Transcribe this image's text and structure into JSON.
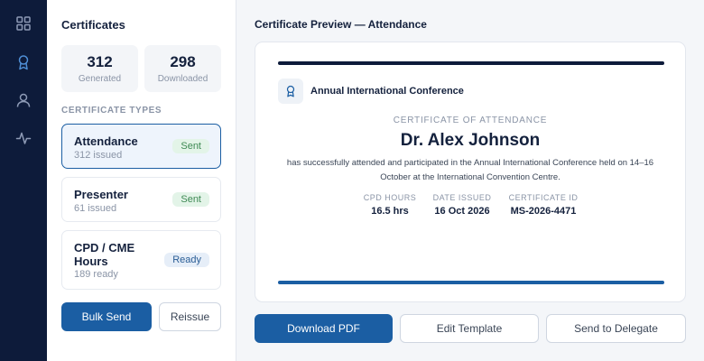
{
  "nav": {
    "items": [
      {
        "icon": "grid-icon",
        "active": false
      },
      {
        "icon": "award-icon",
        "active": true
      },
      {
        "icon": "user-icon",
        "active": false
      },
      {
        "icon": "activity-icon",
        "active": false
      }
    ],
    "colors": {
      "rail": "#0d1b3a",
      "active": "#4f8fd6",
      "inactive": "#8d9ab5"
    }
  },
  "sidebar": {
    "title": "Certificates",
    "stats": [
      {
        "value": "312",
        "label": "Generated"
      },
      {
        "value": "298",
        "label": "Downloaded"
      }
    ],
    "section_label": "CERTIFICATE TYPES",
    "types": [
      {
        "title": "Attendance",
        "sub": "312 issued",
        "badge": "Sent",
        "badge_kind": "sent",
        "selected": true
      },
      {
        "title": "Presenter",
        "sub": "61 issued",
        "badge": "Sent",
        "badge_kind": "sent",
        "selected": false
      },
      {
        "title_line1": "CPD / CME",
        "title_line2": "Hours",
        "sub": "189 ready",
        "badge": "Ready",
        "badge_kind": "ready",
        "selected": false
      }
    ],
    "bulk_send_label": "Bulk Send",
    "reissue_label": "Reissue"
  },
  "preview": {
    "title": "Certificate Preview — Attendance",
    "org_icon": "ribbon-icon",
    "org_name": "Annual International Conference",
    "heading": "CERTIFICATE OF ATTENDANCE",
    "recipient": "Dr. Alex Johnson",
    "body_line1": "has successfully attended and participated in the Annual International Conference held on 14–16",
    "body_line2": "October at the International Convention Centre.",
    "meta": [
      {
        "label": "CPD HOURS",
        "value": "16.5 hrs"
      },
      {
        "label": "DATE ISSUED",
        "value": "16 Oct 2026"
      },
      {
        "label": "CERTIFICATE ID",
        "value": "MS-2026-4471"
      }
    ]
  },
  "actions": {
    "download_label": "Download PDF",
    "edit_label": "Edit Template",
    "send_label": "Send to Delegate"
  },
  "colors": {
    "primary": "#1b5ea3",
    "navy": "#0d1b3a",
    "sent_badge": "#3f8a55",
    "ready_badge": "#2a5d95"
  }
}
